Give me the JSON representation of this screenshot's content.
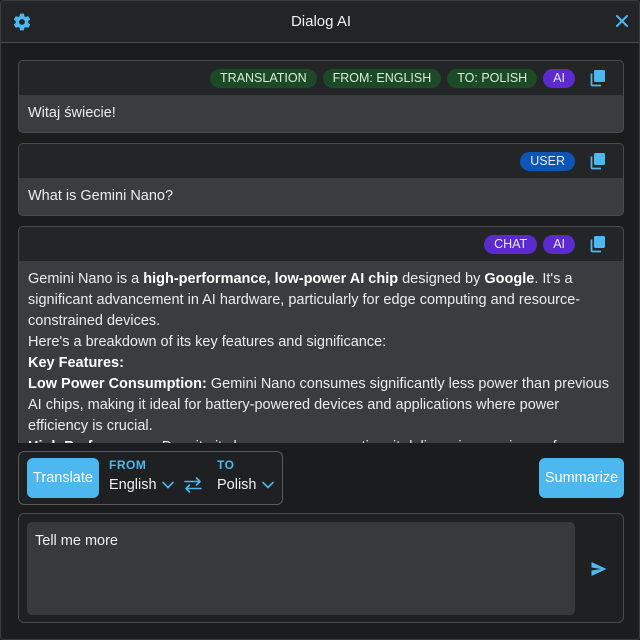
{
  "app": {
    "title": "Dialog AI"
  },
  "messages": [
    {
      "tags": [
        "TRANSLATION",
        "FROM: ENGLISH",
        "TO: POLISH",
        "AI"
      ],
      "text": "Witaj świecie!"
    },
    {
      "tags": [
        "USER"
      ],
      "text": "What is Gemini Nano?"
    },
    {
      "tags": [
        "CHAT",
        "AI"
      ],
      "paragraphs": [
        {
          "segments": [
            {
              "t": "Gemini Nano is a ",
              "b": false
            },
            {
              "t": "high-performance, low-power AI chip",
              "b": true
            },
            {
              "t": " designed by ",
              "b": false
            },
            {
              "t": "Google",
              "b": true
            },
            {
              "t": ". It's a significant advancement in AI hardware, particularly for edge computing and resource-constrained devices.",
              "b": false
            }
          ]
        },
        {
          "segments": [
            {
              "t": "Here's a breakdown of its key features and significance:",
              "b": false
            }
          ]
        },
        {
          "segments": [
            {
              "t": "Key Features:",
              "b": true
            }
          ]
        },
        {
          "segments": [
            {
              "t": "Low Power Consumption:",
              "b": true
            },
            {
              "t": " Gemini Nano consumes significantly less power than previous AI chips, making it ideal for battery-powered devices and applications where power efficiency is crucial.",
              "b": false
            }
          ]
        },
        {
          "segments": [
            {
              "t": "High Performance:",
              "b": true
            },
            {
              "t": " Despite its low power consumption, it delivers impressive performance",
              "b": false
            }
          ]
        }
      ]
    }
  ],
  "controls": {
    "translate_label": "Translate",
    "from_label": "FROM",
    "from_value": "English",
    "to_label": "TO",
    "to_value": "Polish",
    "summarize_label": "Summarize"
  },
  "input": {
    "value": "Tell me more"
  },
  "colors": {
    "accent": "#4db8f0",
    "tag_green": "#1c4a26",
    "tag_purple": "#5b2bd0",
    "tag_blue": "#0e55b8"
  },
  "icons": {
    "settings": "gear-icon",
    "close": "close-icon",
    "copy": "copy-icon",
    "swap": "swap-arrows-icon",
    "dropdown": "chevron-down-icon",
    "send": "send-icon"
  }
}
